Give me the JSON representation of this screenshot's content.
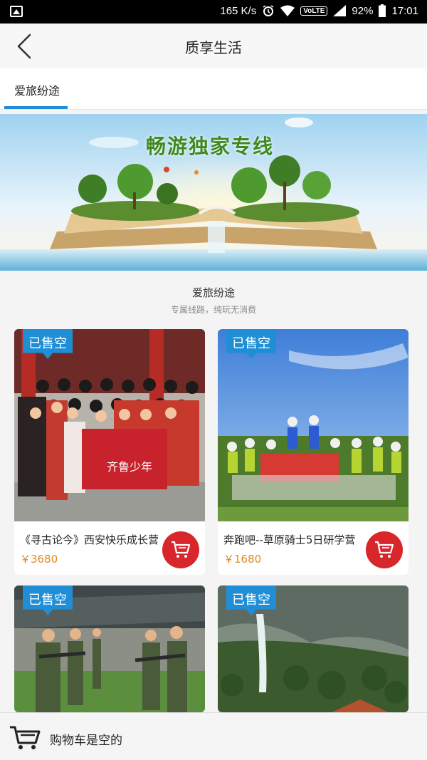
{
  "status_bar": {
    "speed": "165 K/s",
    "network": "VoLTE",
    "battery": "92%",
    "time": "17:01"
  },
  "nav": {
    "title": "质享生活"
  },
  "tabs": [
    {
      "label": "爱旅纷途",
      "active": true
    }
  ],
  "banner": {
    "headline": "畅游独家专线"
  },
  "section": {
    "title": "爱旅纷途",
    "subtitle": "专属线路，纯玩无消费"
  },
  "products": [
    {
      "name": "《寻古论今》西安快乐成长营",
      "price": "￥3680",
      "badge": "已售空",
      "banner_text": "齐鲁少年"
    },
    {
      "name": "奔跑吧--草原骑士5日研学营",
      "price": "￥1680",
      "badge": "已售空"
    },
    {
      "badge": "已售空"
    },
    {
      "badge": "已售空"
    }
  ],
  "bottom_bar": {
    "cart_status": "购物车是空的"
  },
  "colors": {
    "accent": "#1f8ed6",
    "cart_button": "#d8262b",
    "price": "#e08a1e"
  }
}
